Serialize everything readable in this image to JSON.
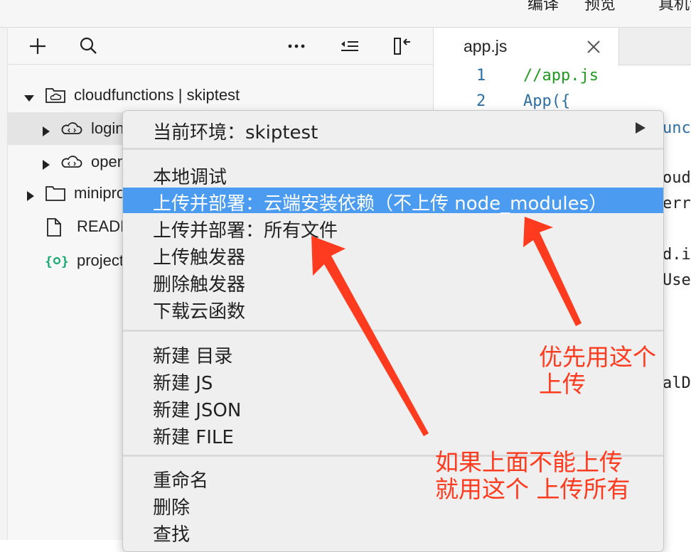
{
  "topbar": {
    "compile_label": "编译",
    "preview_label": "预览",
    "device_label": "真机调试"
  },
  "explorer": {
    "toolbar": {
      "add": "plus-icon",
      "search": "search-icon",
      "more": "more-icon",
      "collapse": "collapse-icon",
      "toggle": "sidebar-toggle-icon"
    },
    "tree": [
      {
        "label": "cloudfunctions | skiptest",
        "icon": "cloud-folder-icon",
        "expanded": true
      },
      {
        "label": "login",
        "icon": "cloud-function-icon",
        "expanded": false
      },
      {
        "label": "openapi",
        "icon": "cloud-function-icon",
        "expanded": false
      },
      {
        "label": "miniprogram",
        "icon": "folder-icon",
        "expanded": false
      },
      {
        "label": "README.md",
        "icon": "file-icon"
      },
      {
        "label": "project.config.json",
        "icon": "json-icon"
      }
    ]
  },
  "editor": {
    "tab_label": "app.js",
    "lines": [
      {
        "num": "1",
        "code": "//app.js"
      },
      {
        "num": "2",
        "code": "App({"
      }
    ],
    "fragments": [
      "unct",
      "oud",
      "err",
      "d.in",
      "User",
      "alDa"
    ]
  },
  "context_menu": {
    "env_label": "当前环境：skiptest",
    "items_group1": [
      "本地调试",
      "上传并部署：云端安装依赖（不上传 node_modules）",
      "上传并部署：所有文件",
      "上传触发器",
      "删除触发器",
      "下载云函数"
    ],
    "highlighted_index": 1,
    "items_group2": [
      "新建 目录",
      "新建 JS",
      "新建 JSON",
      "新建 FILE"
    ],
    "items_group3": [
      "重命名",
      "删除",
      "查找"
    ]
  },
  "annotations": {
    "note1_line1": "优先用这个",
    "note1_line2": "上传",
    "note2_line1": "如果上面不能上传",
    "note2_line2": "就用这个 上传所有"
  },
  "colors": {
    "highlight": "#4b9cf1",
    "annotation": "#ff3b1f",
    "json_icon": "#19a974",
    "line_number": "#2e6fa3",
    "code_comment": "#229922"
  }
}
